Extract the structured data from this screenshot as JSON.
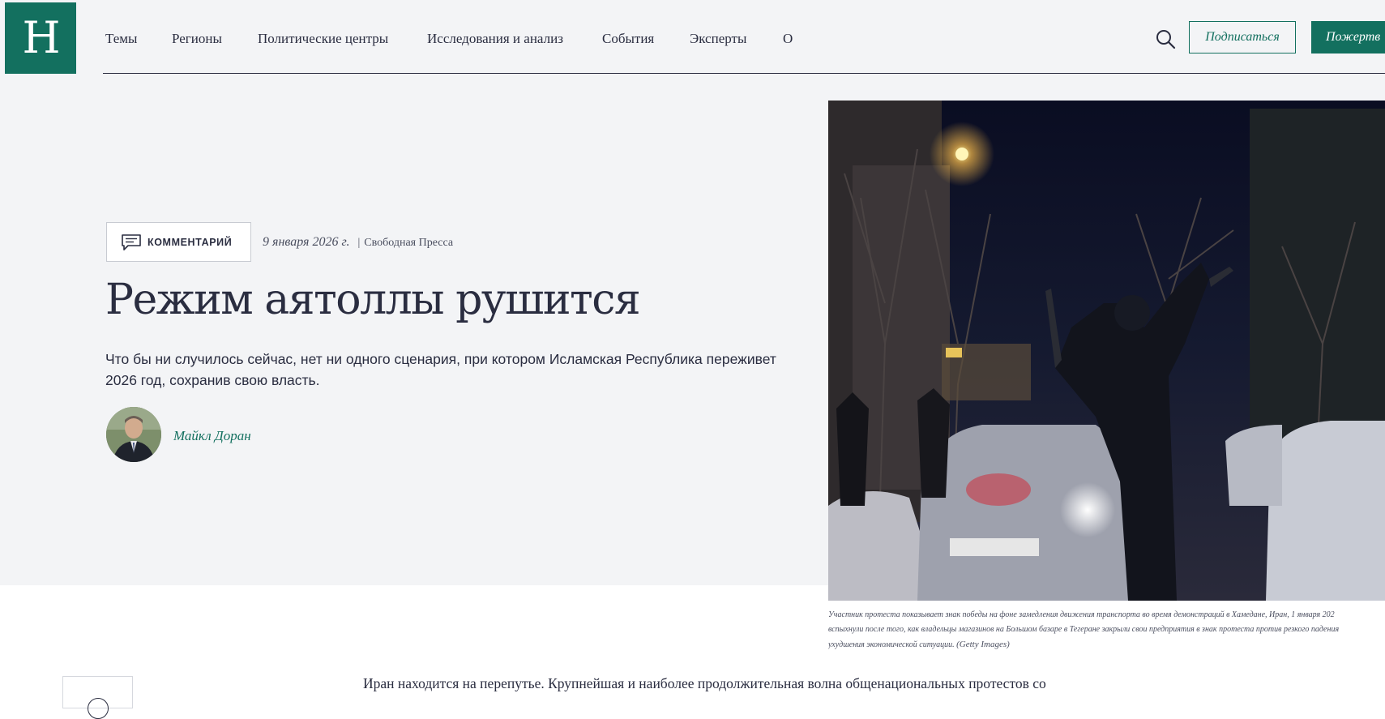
{
  "logo": {
    "letter": "H"
  },
  "nav": {
    "items": [
      {
        "label": "Темы"
      },
      {
        "label": "Регионы"
      },
      {
        "label": "Политические центры"
      },
      {
        "label": "Исследования и анализ"
      },
      {
        "label": "События"
      },
      {
        "label": "Эксперты"
      },
      {
        "label": "О"
      }
    ],
    "subscribe_label": "Подписаться",
    "donate_label": "Пожертв"
  },
  "article": {
    "type_label": "КОММЕНТАРИЙ",
    "date": "9 января 2026 г.",
    "separator": "|",
    "source": "Свободная Пресса",
    "title": "Режим аятоллы рушится",
    "dek": "Что бы ни случилось сейчас, нет ни одного сценария, при котором Исламская Республика переживет 2026 год, сохранив свою власть.",
    "author": "Майкл Доран",
    "caption_line1": "Участник протеста показывает знак победы на фоне замедления движения транспорта во время демонстраций в Хамедане, Иран, 1 января 202",
    "caption_line2": "вспыхнули после того, как владельцы магазинов на Большом базаре в Тегеране закрыли свои предприятия в знак протеста против резкого падения",
    "caption_line3": "ухудшения экономической ситуации.",
    "caption_credit": "(Getty Images)",
    "body_first_line": "Иран находится на перепутье. Крупнейшая и наиболее продолжительная волна общенациональных протестов со"
  },
  "colors": {
    "brand": "#13705f",
    "text": "#2a2d40",
    "hero_bg": "#f3f4f6"
  },
  "icons": {
    "search": "search-icon",
    "comment": "comment-icon"
  }
}
